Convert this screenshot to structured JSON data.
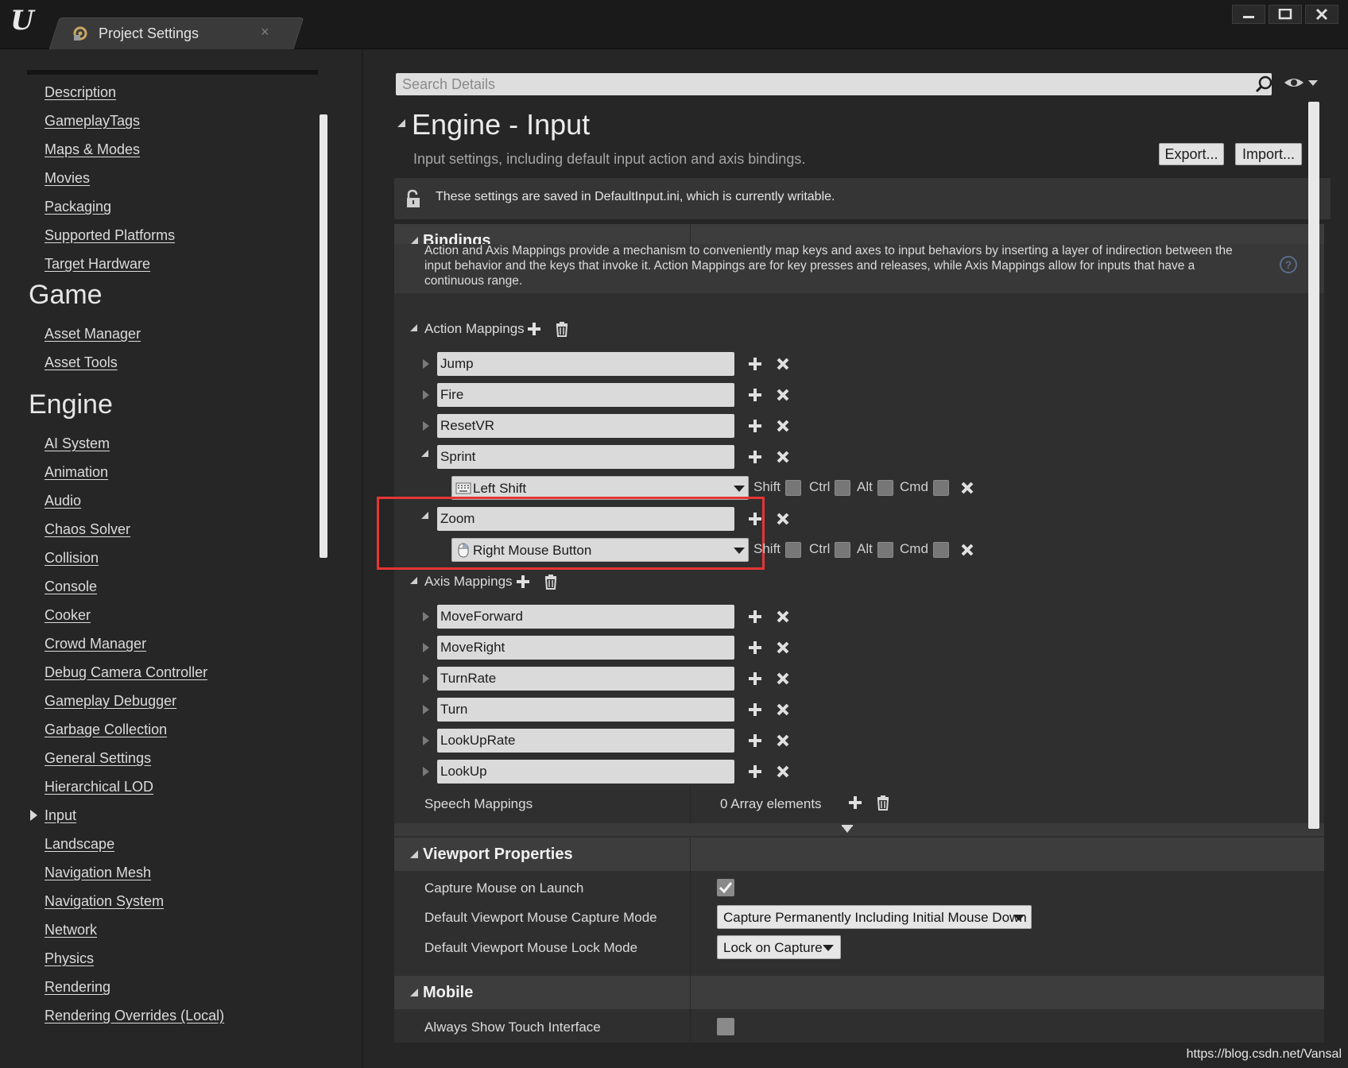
{
  "window": {
    "tab_title": "Project Settings",
    "tab_close": "×"
  },
  "sidebar": {
    "top_items": [
      "Description",
      "GameplayTags",
      "Maps & Modes",
      "Movies",
      "Packaging",
      "Supported Platforms",
      "Target Hardware"
    ],
    "sections": [
      {
        "title": "Game",
        "items": [
          "Asset Manager",
          "Asset Tools"
        ]
      },
      {
        "title": "Engine",
        "items": [
          "AI System",
          "Animation",
          "Audio",
          "Chaos Solver",
          "Collision",
          "Console",
          "Cooker",
          "Crowd Manager",
          "Debug Camera Controller",
          "Gameplay Debugger",
          "Garbage Collection",
          "General Settings",
          "Hierarchical LOD",
          "Input",
          "Landscape",
          "Navigation Mesh",
          "Navigation System",
          "Network",
          "Physics",
          "Rendering",
          "Rendering Overrides (Local)"
        ]
      }
    ],
    "selected": "Input"
  },
  "search": {
    "placeholder": "Search Details"
  },
  "header": {
    "title": "Engine - Input",
    "subtitle": "Input settings, including default input action and axis bindings.",
    "export_label": "Export...",
    "import_label": "Import..."
  },
  "notice": {
    "text": "These settings are saved in DefaultInput.ini, which is currently writable."
  },
  "bindings": {
    "title": "Bindings",
    "description": "Action and Axis Mappings provide a mechanism to conveniently map keys and axes to input behaviors by inserting a layer of indirection between the input behavior and the keys that invoke it. Action Mappings are for key presses and releases, while Axis Mappings allow for inputs that have a continuous range.",
    "action_mappings_label": "Action Mappings",
    "action_mappings": [
      {
        "name": "Jump",
        "expanded": false
      },
      {
        "name": "Fire",
        "expanded": false
      },
      {
        "name": "ResetVR",
        "expanded": false
      },
      {
        "name": "Sprint",
        "expanded": true,
        "key": "Left Shift",
        "key_icon": "keyboard-icon"
      },
      {
        "name": "Zoom",
        "expanded": true,
        "key": "Right Mouse Button",
        "key_icon": "mouse-icon"
      }
    ],
    "modifiers": [
      "Shift",
      "Ctrl",
      "Alt",
      "Cmd"
    ],
    "axis_mappings_label": "Axis Mappings",
    "axis_mappings": [
      "MoveForward",
      "MoveRight",
      "TurnRate",
      "Turn",
      "LookUpRate",
      "LookUp"
    ],
    "speech_mappings_label": "Speech Mappings",
    "speech_mappings_value": "0 Array elements"
  },
  "viewport": {
    "title": "Viewport Properties",
    "capture_mouse_label": "Capture Mouse on Launch",
    "capture_mouse_checked": true,
    "capture_mode_label": "Default Viewport Mouse Capture Mode",
    "capture_mode_value": "Capture Permanently Including Initial Mouse Down",
    "lock_mode_label": "Default Viewport Mouse Lock Mode",
    "lock_mode_value": "Lock on Capture"
  },
  "mobile": {
    "title": "Mobile",
    "touch_label": "Always Show Touch Interface",
    "touch_checked": false
  },
  "watermark": "https://blog.csdn.net/Vansal",
  "colors": {
    "highlight": "#e53535",
    "background": "#262626",
    "field": "#dadada"
  }
}
